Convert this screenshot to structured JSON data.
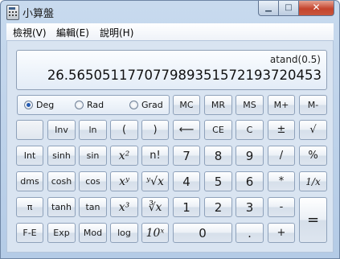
{
  "window": {
    "title": "小算盤"
  },
  "menu": {
    "view": "檢視(V)",
    "edit": "編輯(E)",
    "help": "說明(H)"
  },
  "display": {
    "expression": "atand(0.5)",
    "result": "26.565051177077989351572193720453"
  },
  "angle_modes": {
    "deg": "Deg",
    "rad": "Rad",
    "grad": "Grad",
    "selected": "Deg"
  },
  "memory": {
    "mc": "MC",
    "mr": "MR",
    "ms": "MS",
    "mplus": "M+",
    "mminus": "M-"
  },
  "keys": {
    "inv": "Inv",
    "ln": "ln",
    "lparen": "(",
    "rparen": ")",
    "backspace": "⟵",
    "ce": "CE",
    "c": "C",
    "plusminus": "±",
    "sqrt": "√",
    "int": "Int",
    "sinh": "sinh",
    "sin": "sin",
    "x2": "x²",
    "fact": "n!",
    "n7": "7",
    "n8": "8",
    "n9": "9",
    "div": "/",
    "percent": "%",
    "dms": "dms",
    "cosh": "cosh",
    "cos": "cos",
    "xy": "xʸ",
    "yroot": "ʸ√x",
    "n4": "4",
    "n5": "5",
    "n6": "6",
    "mul": "*",
    "recip": "1/x",
    "pi": "π",
    "tanh": "tanh",
    "tan": "tan",
    "x3": "x³",
    "cbrt": "∛x",
    "n1": "1",
    "n2": "2",
    "n3": "3",
    "sub": "-",
    "eq": "=",
    "fe": "F-E",
    "exp": "Exp",
    "mod": "Mod",
    "log": "log",
    "tenx": "10ˣ",
    "n0": "0",
    "dot": ".",
    "add": "+"
  }
}
